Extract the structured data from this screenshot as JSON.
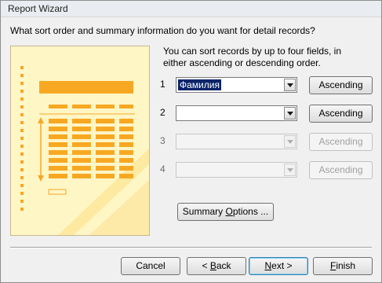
{
  "window": {
    "title": "Report Wizard"
  },
  "heading": "What sort order and summary information do you want for detail records?",
  "instructions": "You can sort records by up to four fields, in either ascending or descending order.",
  "sort_fields": [
    {
      "number": "1",
      "value": "Фамилия",
      "enabled": true,
      "order": "Ascending"
    },
    {
      "number": "2",
      "value": "",
      "enabled": true,
      "order": "Ascending"
    },
    {
      "number": "3",
      "value": "",
      "enabled": false,
      "order": "Ascending"
    },
    {
      "number": "4",
      "value": "",
      "enabled": false,
      "order": "Ascending"
    }
  ],
  "summary_button": {
    "pre": "Summary ",
    "mnemonic": "O",
    "post": "ptions ..."
  },
  "footer": {
    "cancel": "Cancel",
    "back": {
      "pre": "< ",
      "mnemonic": "B",
      "post": "ack"
    },
    "next": {
      "pre": "",
      "mnemonic": "N",
      "post": "ext >"
    },
    "finish": {
      "pre": "",
      "mnemonic": "F",
      "post": "inish"
    }
  },
  "colors": {
    "illustration_bg": "#fff6c6",
    "illustration_accent": "#f7a823",
    "selection": "#0a246a"
  },
  "icons": [
    "report-layout-illustration",
    "dropdown-arrow-icon"
  ]
}
